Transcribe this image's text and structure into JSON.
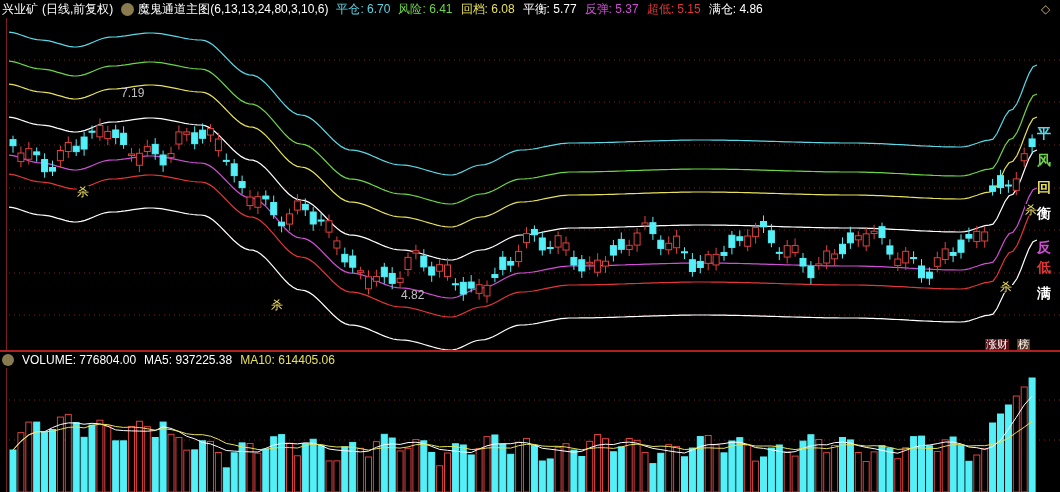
{
  "header": {
    "stock": "兴业矿",
    "period": "(日线,前复权)",
    "indicator": "魔鬼通道主图(6,13,13,24,80,3,10,6)",
    "values": [
      {
        "label": "平仓:",
        "value": "6.70",
        "color": "#5ad8e6"
      },
      {
        "label": "风险:",
        "value": "6.41",
        "color": "#6cd648"
      },
      {
        "label": "回档:",
        "value": "6.08",
        "color": "#e6e05a"
      },
      {
        "label": "平衡:",
        "value": "5.77",
        "color": "#ffffff"
      },
      {
        "label": "反弹:",
        "value": "5.37",
        "color": "#d04fd6"
      },
      {
        "label": "超低:",
        "value": "5.15",
        "color": "#e03636"
      },
      {
        "label": "满仓:",
        "value": "4.86",
        "color": "#ffffff"
      }
    ],
    "corner": "◇"
  },
  "chart": {
    "price_labels": [
      "7.19",
      "4.82"
    ],
    "signals": [
      "杀",
      "杀",
      "杀",
      "杀"
    ],
    "line_labels": [
      {
        "text": "平",
        "color": "#5ad8e6"
      },
      {
        "text": "风",
        "color": "#6cd648"
      },
      {
        "text": "回",
        "color": "#e6e05a"
      },
      {
        "text": "衡",
        "color": "#ffffff"
      },
      {
        "text": "反",
        "color": "#d04fd6"
      },
      {
        "text": "低",
        "color": "#e03636"
      },
      {
        "text": "满",
        "color": "#ffffff"
      }
    ],
    "badges": [
      "涨财",
      "榜"
    ]
  },
  "volume": {
    "values": [
      {
        "label": "VOLUME:",
        "value": "776804.00",
        "color": "#ffffff"
      },
      {
        "label": "MA5:",
        "value": "937225.38",
        "color": "#ffffff"
      },
      {
        "label": "MA10:",
        "value": "614405.06",
        "color": "#e6e05a"
      }
    ]
  }
}
